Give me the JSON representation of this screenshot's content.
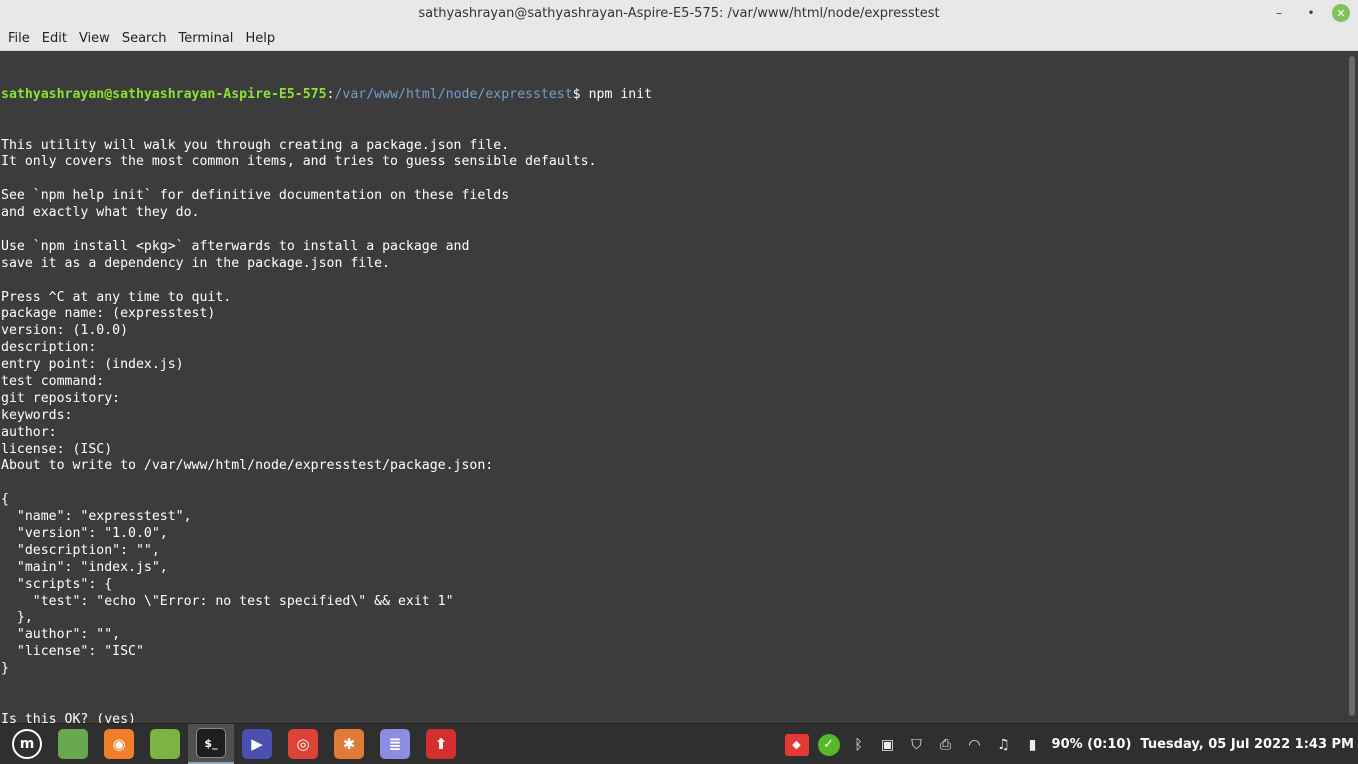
{
  "window": {
    "title": "sathyashrayan@sathyashrayan-Aspire-E5-575: /var/www/html/node/expresstest",
    "minimize": "–",
    "maximize": "•",
    "close": "✕"
  },
  "menu": {
    "items": [
      "File",
      "Edit",
      "View",
      "Search",
      "Terminal",
      "Help"
    ]
  },
  "terminal": {
    "prompt_user": "sathyashrayan@sathyashrayan-Aspire-E5-575",
    "prompt_sep": ":",
    "prompt_path": "/var/www/html/node/expresstest",
    "prompt_end": "$ ",
    "command": "npm init",
    "output": [
      "This utility will walk you through creating a package.json file.",
      "It only covers the most common items, and tries to guess sensible defaults.",
      "",
      "See `npm help init` for definitive documentation on these fields",
      "and exactly what they do.",
      "",
      "Use `npm install <pkg>` afterwards to install a package and",
      "save it as a dependency in the package.json file.",
      "",
      "Press ^C at any time to quit.",
      "package name: (expresstest)",
      "version: (1.0.0)",
      "description:",
      "entry point: (index.js)",
      "test command:",
      "git repository:",
      "keywords:",
      "author:",
      "license: (ISC)",
      "About to write to /var/www/html/node/expresstest/package.json:",
      "",
      "{",
      "  \"name\": \"expresstest\",",
      "  \"version\": \"1.0.0\",",
      "  \"description\": \"\",",
      "  \"main\": \"index.js\",",
      "  \"scripts\": {",
      "    \"test\": \"echo \\\"Error: no test specified\\\" && exit 1\"",
      "  },",
      "  \"author\": \"\",",
      "  \"license\": \"ISC\"",
      "}",
      "",
      "",
      "Is this OK? (yes)"
    ]
  },
  "taskbar": {
    "apps": [
      {
        "name": "files",
        "glyph": "",
        "color": "#6aa84f"
      },
      {
        "name": "firefox",
        "glyph": "◉",
        "color": "#f07f2a"
      },
      {
        "name": "folder",
        "glyph": "",
        "color": "#7cb342"
      },
      {
        "name": "terminal",
        "glyph": "$_",
        "color": "#1e1e1e"
      },
      {
        "name": "media-player",
        "glyph": "▶",
        "color": "#4b4fb0"
      },
      {
        "name": "chrome",
        "glyph": "◎",
        "color": "#db4437"
      },
      {
        "name": "git-client",
        "glyph": "✱",
        "color": "#e07b39"
      },
      {
        "name": "text-editor",
        "glyph": "≣",
        "color": "#8c8ce0"
      },
      {
        "name": "app-red",
        "glyph": "⬆",
        "color": "#d32f2f"
      }
    ],
    "battery": "90% (0:10)",
    "clock": "Tuesday, 05 Jul 2022  1:43 PM"
  }
}
